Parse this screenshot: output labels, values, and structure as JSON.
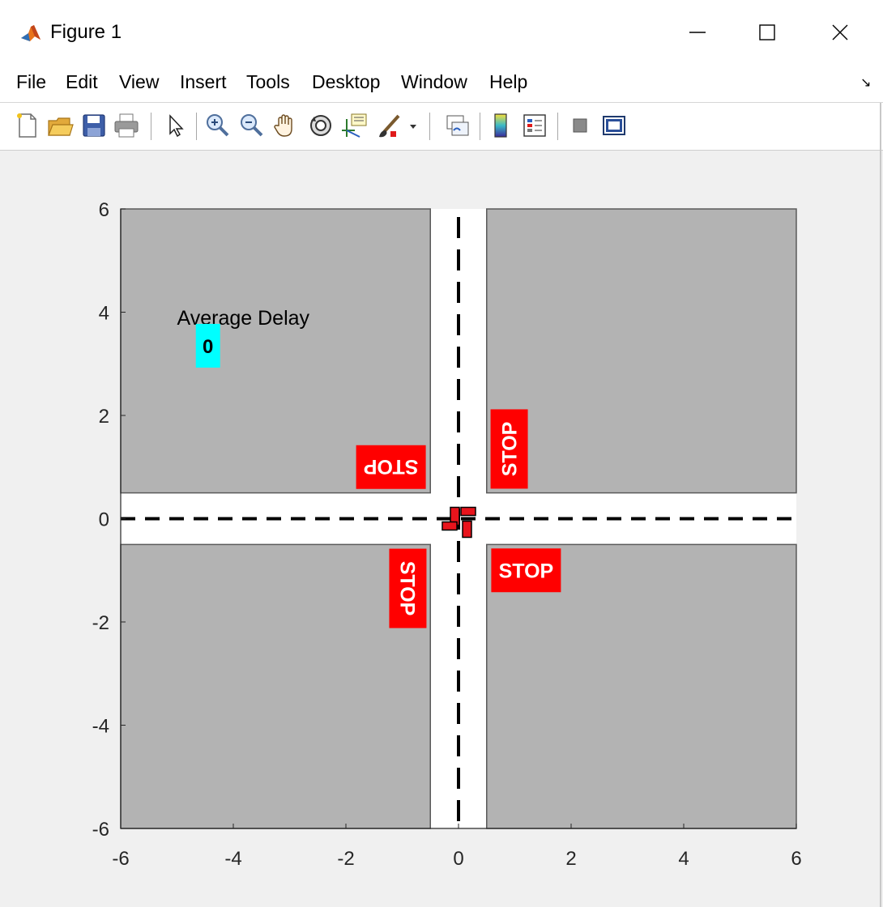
{
  "window": {
    "title": "Figure 1",
    "controls": {
      "minimize_glyph": "—",
      "maximize_glyph": "☐",
      "close_glyph": "✕"
    }
  },
  "menu": {
    "items": [
      "File",
      "Edit",
      "View",
      "Insert",
      "Tools",
      "Desktop",
      "Window",
      "Help"
    ],
    "dock_glyph": "↘"
  },
  "toolbar": {
    "icons": [
      "new-figure-icon",
      "open-file-icon",
      "save-icon",
      "print-icon",
      "edit-plot-arrow-icon",
      "zoom-in-icon",
      "zoom-out-icon",
      "pan-hand-icon",
      "rotate-3d-icon",
      "data-cursor-icon",
      "brush-icon",
      "brush-dropdown-icon",
      "link-plot-icon",
      "colorbar-icon",
      "legend-icon",
      "hide-plot-tools-icon",
      "show-plot-tools-icon"
    ]
  },
  "chart_data": {
    "type": "intersection-diagram",
    "xlim": [
      -6,
      6
    ],
    "ylim": [
      -6,
      6
    ],
    "xticks": [
      "-6",
      "-4",
      "-2",
      "0",
      "2",
      "4",
      "6"
    ],
    "yticks": [
      "6",
      "4",
      "2",
      "0",
      "-2",
      "-4",
      "-6"
    ],
    "grid": false,
    "blocks": [
      {
        "name": "top-left",
        "x": [
          -6,
          -0.5
        ],
        "y": [
          0.5,
          6
        ]
      },
      {
        "name": "top-right",
        "x": [
          0.5,
          6
        ],
        "y": [
          0.5,
          6
        ]
      },
      {
        "name": "bottom-left",
        "x": [
          -6,
          -0.5
        ],
        "y": [
          -6,
          -0.5
        ]
      },
      {
        "name": "bottom-right",
        "x": [
          0.5,
          6
        ],
        "y": [
          -6,
          -0.5
        ]
      }
    ],
    "center_lines": {
      "horizontal_y": 0,
      "vertical_x": 0,
      "style": "dashed"
    },
    "stop_signs": [
      {
        "text": "STOP",
        "x": -1.2,
        "y": 1.0,
        "orientation": "upside-down"
      },
      {
        "text": "STOP",
        "x": 0.9,
        "y": 1.35,
        "orientation": "vertical-up"
      },
      {
        "text": "STOP",
        "x": -0.9,
        "y": -1.35,
        "orientation": "vertical-down"
      },
      {
        "text": "STOP",
        "x": 1.2,
        "y": -1.0,
        "orientation": "normal"
      }
    ],
    "annotation": {
      "label": "Average Delay",
      "label_x": -5,
      "label_y": 3.9
    },
    "average_delay": {
      "value": "0",
      "x": -4.45,
      "y": 3.35
    },
    "cars_at_center": 4,
    "colors": {
      "block_fill": "#b3b3b3",
      "block_edge": "#5a5a5a",
      "road": "#ffffff",
      "stop_fill": "#ff0000",
      "stop_text": "#ffffff",
      "delay_box": "#00ffff",
      "car_fill": "#e8141c"
    }
  }
}
